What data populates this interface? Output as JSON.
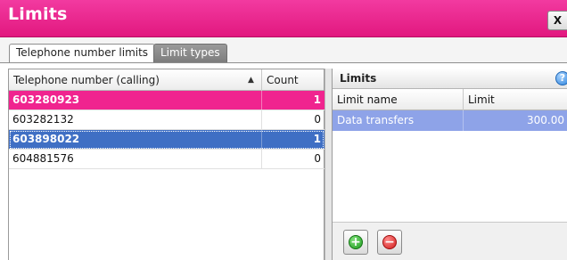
{
  "window": {
    "title": "Limits",
    "close_label": "X"
  },
  "tabs": [
    {
      "label": "Telephone number limits",
      "active": true
    },
    {
      "label": "Limit types",
      "active": false
    }
  ],
  "numbers_grid": {
    "columns": [
      "Telephone number (calling)",
      "Count"
    ],
    "sort_indicator": "▲",
    "rows": [
      {
        "number": "603280923",
        "count": "1",
        "state": "highlighted"
      },
      {
        "number": "603282132",
        "count": "0",
        "state": "normal"
      },
      {
        "number": "603898022",
        "count": "1",
        "state": "selected"
      },
      {
        "number": "604881576",
        "count": "0",
        "state": "normal"
      }
    ]
  },
  "limits_panel": {
    "title": "Limits",
    "help_glyph": "?",
    "columns": [
      "Limit name",
      "Limit"
    ],
    "rows": [
      {
        "name": "Data transfers",
        "limit": "300.00"
      }
    ],
    "add_glyph": "+",
    "remove_glyph": "−"
  },
  "colors": {
    "title_bar": "#e8208a",
    "highlight_row": "#f0248f",
    "selected_row": "#3f6fc4",
    "limit_row": "#8ea3e8"
  },
  "icons": [
    "close-icon",
    "sort-ascending-icon",
    "help-icon",
    "add-icon",
    "remove-icon"
  ]
}
